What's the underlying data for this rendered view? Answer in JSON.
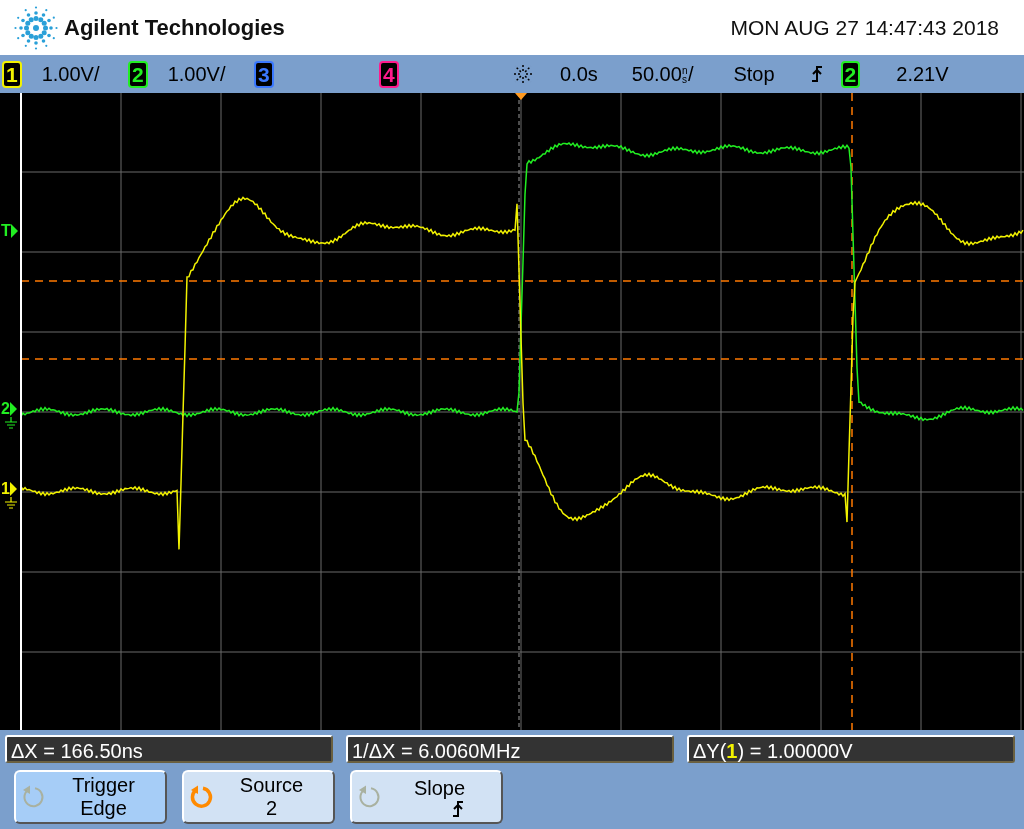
{
  "header": {
    "brand": "Agilent Technologies",
    "datetime": "MON AUG 27 14:47:43 2018"
  },
  "status_bar": {
    "channels": [
      {
        "number": "1",
        "color": "#f2f200",
        "scale": "1.00V/"
      },
      {
        "number": "2",
        "color": "#22ee22",
        "scale": "1.00V/"
      },
      {
        "number": "3",
        "color": "#3a78ff"
      },
      {
        "number": "4",
        "color": "#ff1a8c"
      }
    ],
    "delay": "0.0s",
    "timebase": {
      "value": "50.00",
      "unit": "ns",
      "per": "/"
    },
    "run_state": "Stop",
    "trigger": {
      "source": "2",
      "color": "#22ee22",
      "reading": "2.21V"
    }
  },
  "screen": {
    "markers": [
      {
        "kind": "trigger",
        "label": "T",
        "color": "#22ee22"
      },
      {
        "kind": "ground",
        "label": "2",
        "color": "#22ee22"
      },
      {
        "kind": "ground",
        "label": "1",
        "color": "#f2f200"
      }
    ]
  },
  "measurements": [
    {
      "text": "ΔX = 166.50ns"
    },
    {
      "text": "1/ΔX = 6.0060MHz"
    },
    {
      "prefix": "ΔY(",
      "channel": "1",
      "color": "#f2f200",
      "suffix": ") = 1.00000V"
    }
  ],
  "softkeys": [
    {
      "label": "Trigger",
      "value": "Edge",
      "kind": "text",
      "selected": true,
      "knob_active": false
    },
    {
      "label": "Source",
      "value": "2",
      "kind": "text",
      "selected": false,
      "knob_active": true
    },
    {
      "label": "Slope",
      "kind": "slope",
      "selected": false,
      "knob_active": false
    }
  ]
}
